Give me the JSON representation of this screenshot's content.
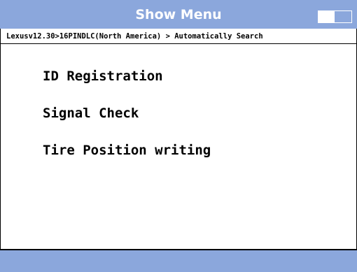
{
  "header": {
    "title": "Show Menu",
    "battery_icon": "battery-icon"
  },
  "breadcrumb": "Lexusv12.30>16PINDLC(North America) > Automatically Search",
  "menu": {
    "items": [
      {
        "label": "ID Registration"
      },
      {
        "label": "Signal Check"
      },
      {
        "label": "Tire Position writing"
      }
    ]
  },
  "colors": {
    "bar": "#8ba7dc",
    "title_text": "#ffffff",
    "background": "#ffffff",
    "text": "#000000"
  }
}
